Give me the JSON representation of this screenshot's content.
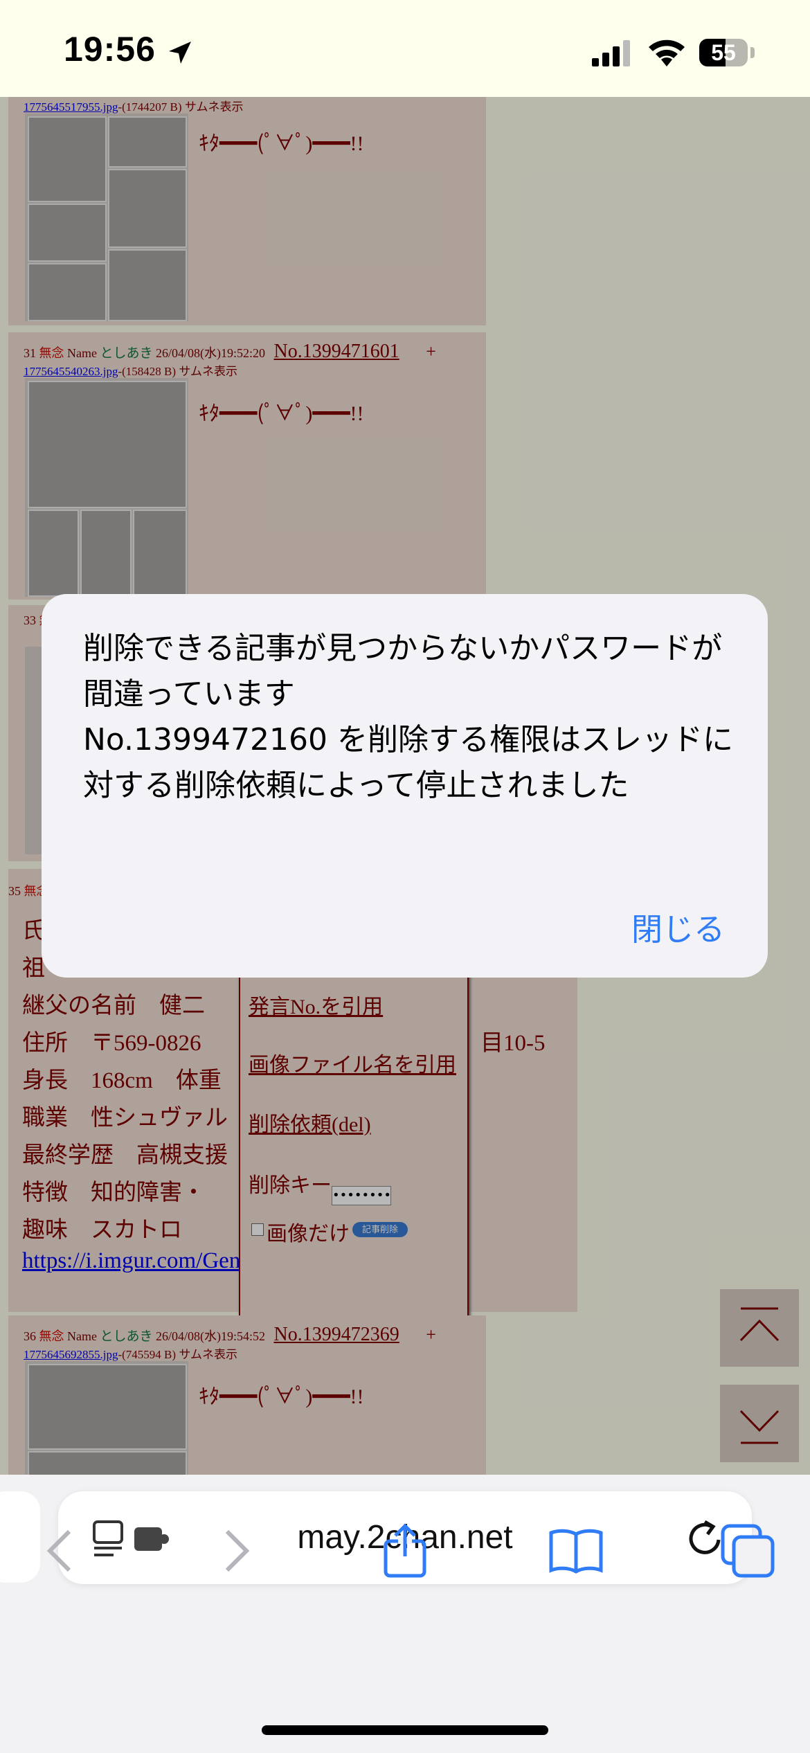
{
  "status": {
    "time": "19:56",
    "battery": "55"
  },
  "posts": [
    {
      "file": "1775645517955.jpg",
      "file_meta": "-(1744207 B)",
      "thumb_label": "サムネ表示",
      "body": "ｷﾀ━━━(ﾟ∀ﾟ)━━━!!"
    },
    {
      "num": "31",
      "anon": "無念",
      "name_label": "Name",
      "name": "としあき",
      "date": "26/04/08(水)19:52:20",
      "no": "No.1399471601",
      "plus": "+",
      "file": "1775645540263.jpg",
      "file_meta": "-(158428 B)",
      "thumb_label": "サムネ表示",
      "body": "ｷﾀ━━━(ﾟ∀ﾟ)━━━!!"
    },
    {
      "num": "33",
      "anon": "無念"
    },
    {
      "num": "35",
      "anon": "無念"
    },
    {
      "num": "36",
      "anon": "無念",
      "name_label": "Name",
      "name": "としあき",
      "date": "26/04/08(水)19:54:52",
      "no": "No.1399472369",
      "plus": "+",
      "file": "1775645692855.jpg",
      "file_meta": "-(745594 B)",
      "thumb_label": "サムネ表示",
      "body": "ｷﾀ━━━(ﾟ∀ﾟ)━━━!!"
    }
  ],
  "profile_lines": [
    "氏",
    "祖",
    "継父の名前　健二",
    "住所　〒569-0826",
    "身長　168cm　体重",
    "職業　性シュヴァル",
    "最終学歴　高槻支援",
    "特徴　知的障害・",
    "趣味　スカトロ"
  ],
  "profile_line_tails": {
    "address_tail": "目10-5"
  },
  "profile_link": "https://i.imgur.com/GenKbyu.jpeg",
  "popup_menu": {
    "quote_no": "発言No.を引用",
    "quote_file": "画像ファイル名を引用",
    "del_request": "削除依頼(del)",
    "delete_key_label": "削除キー",
    "delete_key_value": "••••••••",
    "image_only": "画像だけ",
    "delete_button": "記事削除"
  },
  "alert": {
    "message": "削除できる記事が見つからないかパスワードが間違っています\nNo.1399472160 を削除する権限はスレッドに対する削除依頼によって停止されました",
    "close_label": "閉じる"
  },
  "browser": {
    "url": "may.2chan.net"
  }
}
